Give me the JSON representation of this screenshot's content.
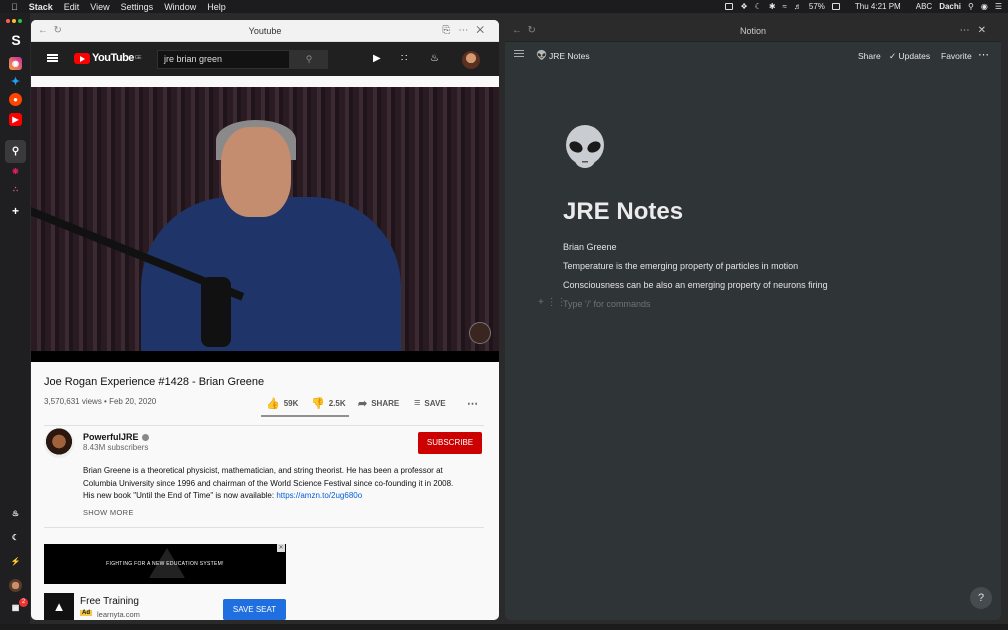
{
  "menubar": {
    "app": "Stack",
    "items": [
      "Edit",
      "View",
      "Settings",
      "Window",
      "Help"
    ],
    "battery": "57%",
    "clock": "Thu 4:21 PM",
    "input_source": "ABC",
    "user": "Dachi"
  },
  "dock": {
    "items": [
      "stack-logo",
      "instagram",
      "twitter",
      "reddit",
      "youtube",
      "search",
      "slack",
      "asana",
      "add"
    ],
    "badge_count": "2"
  },
  "youtube_window": {
    "title": "Youtube",
    "logo_text": "YouTube",
    "logo_region": "GE",
    "search_value": "jre brian green",
    "video": {
      "title": "Joe Rogan Experience #1428 - Brian Greene",
      "meta": "3,570,631 views • Feb 20, 2020",
      "likes": "59K",
      "dislikes": "2.5K",
      "share_label": "SHARE",
      "save_label": "SAVE",
      "like_ratio": 0.96
    },
    "channel": {
      "name": "PowerfulJRE",
      "subscribers": "8.43M subscribers",
      "subscribe_label": "SUBSCRIBE"
    },
    "description": {
      "text": "Brian Greene is a theoretical physicist, mathematician, and string theorist. He has been a professor at Columbia University since 1996 and chairman of the World Science Festival since co-founding it in 2008. His new book \"Until the End of Time\" is now available: ",
      "link": "https://amzn.to/2ug680o",
      "show_more": "SHOW MORE"
    },
    "ad": {
      "banner_text": "FIGHTING FOR A NEW EDUCATION SYSTEM!",
      "title": "Free Training",
      "badge": "Ad",
      "domain": "learnyta.com",
      "button": "SAVE SEAT"
    }
  },
  "notion_window": {
    "title": "Notion",
    "breadcrumb": "JRE Notes",
    "share": "Share",
    "updates": "Updates",
    "favorite": "Favorite",
    "page_title": "JRE Notes",
    "lines": [
      "Brian Greene",
      "Temperature is the emerging property of particles in motion",
      "Consciousness can be also an emerging property of neurons firing"
    ],
    "placeholder": "Type '/' for commands",
    "help": "?"
  }
}
